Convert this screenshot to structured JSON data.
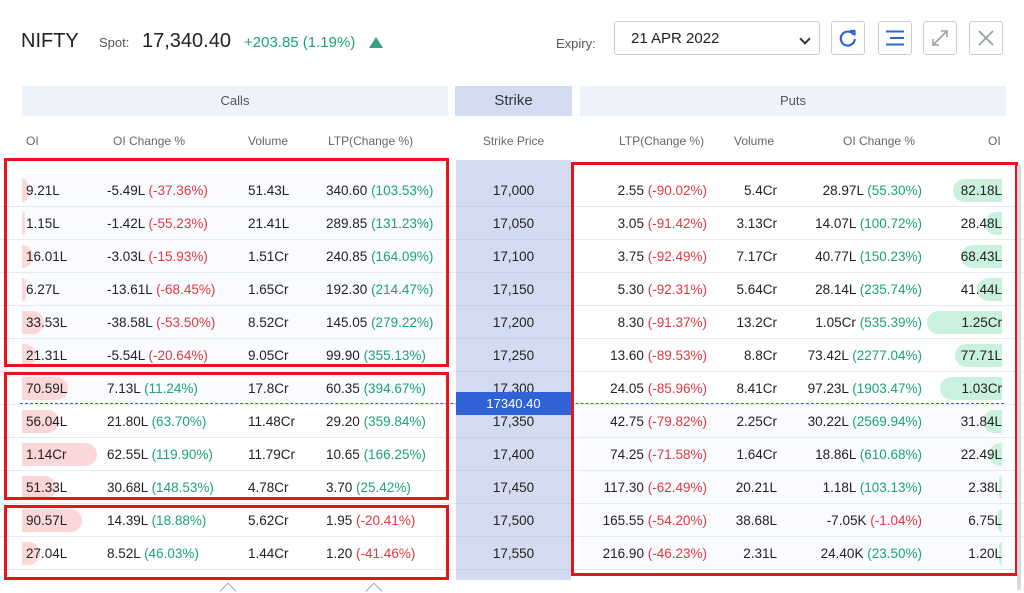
{
  "header": {
    "symbol": "NIFTY",
    "spot_label": "Spot:",
    "spot_value": "17,340.40",
    "spot_change": "+203.85 (1.19%)",
    "expiry_label": "Expiry:",
    "expiry_value": "21 APR 2022",
    "icons": [
      "refresh-icon",
      "menu-lines-icon",
      "expand-icon",
      "close-icon"
    ]
  },
  "sections": {
    "calls": "Calls",
    "strike": "Strike",
    "puts": "Puts"
  },
  "columns": {
    "calls": [
      "OI",
      "OI Change %",
      "Volume",
      "LTP(Change %)"
    ],
    "strike": "Strike Price",
    "puts": [
      "LTP(Change %)",
      "Volume",
      "OI Change %",
      "OI"
    ]
  },
  "spot_marker": "17340.40",
  "colors": {
    "accent": "#2f62d6",
    "positive": "#1aa37a",
    "negative": "#e0383e",
    "highlight": "#e8141c"
  },
  "rows": [
    {
      "strike": "17,000",
      "c_oi": "9.21L",
      "c_chg": "-5.49L",
      "c_chg_pct": "(-37.36%)",
      "c_vol": "51.43L",
      "c_ltp": "340.60",
      "c_ltp_pct": "(103.53%)",
      "p_ltp": "2.55",
      "p_ltp_pct": "(-90.02%)",
      "p_vol": "5.4Cr",
      "p_chg": "28.97L",
      "p_chg_pct": "(55.30%)",
      "p_oi": "82.18L"
    },
    {
      "strike": "17,050",
      "c_oi": "1.15L",
      "c_chg": "-1.42L",
      "c_chg_pct": "(-55.23%)",
      "c_vol": "21.41L",
      "c_ltp": "289.85",
      "c_ltp_pct": "(131.23%)",
      "p_ltp": "3.05",
      "p_ltp_pct": "(-91.42%)",
      "p_vol": "3.13Cr",
      "p_chg": "14.07L",
      "p_chg_pct": "(100.72%)",
      "p_oi": "28.48L"
    },
    {
      "strike": "17,100",
      "c_oi": "16.01L",
      "c_chg": "-3.03L",
      "c_chg_pct": "(-15.93%)",
      "c_vol": "1.51Cr",
      "c_ltp": "240.85",
      "c_ltp_pct": "(164.09%)",
      "p_ltp": "3.75",
      "p_ltp_pct": "(-92.49%)",
      "p_vol": "7.17Cr",
      "p_chg": "40.77L",
      "p_chg_pct": "(150.23%)",
      "p_oi": "68.43L"
    },
    {
      "strike": "17,150",
      "c_oi": "6.27L",
      "c_chg": "-13.61L",
      "c_chg_pct": "(-68.45%)",
      "c_vol": "1.65Cr",
      "c_ltp": "192.30",
      "c_ltp_pct": "(214.47%)",
      "p_ltp": "5.30",
      "p_ltp_pct": "(-92.31%)",
      "p_vol": "5.64Cr",
      "p_chg": "28.14L",
      "p_chg_pct": "(235.74%)",
      "p_oi": "41.44L"
    },
    {
      "strike": "17,200",
      "c_oi": "33.53L",
      "c_chg": "-38.58L",
      "c_chg_pct": "(-53.50%)",
      "c_vol": "8.52Cr",
      "c_ltp": "145.05",
      "c_ltp_pct": "(279.22%)",
      "p_ltp": "8.30",
      "p_ltp_pct": "(-91.37%)",
      "p_vol": "13.2Cr",
      "p_chg": "1.05Cr",
      "p_chg_pct": "(535.39%)",
      "p_oi": "1.25Cr"
    },
    {
      "strike": "17,250",
      "c_oi": "21.31L",
      "c_chg": "-5.54L",
      "c_chg_pct": "(-20.64%)",
      "c_vol": "9.05Cr",
      "c_ltp": "99.90",
      "c_ltp_pct": "(355.13%)",
      "p_ltp": "13.60",
      "p_ltp_pct": "(-89.53%)",
      "p_vol": "8.8Cr",
      "p_chg": "73.42L",
      "p_chg_pct": "(2277.04%)",
      "p_oi": "77.71L"
    },
    {
      "strike": "17,300",
      "c_oi": "70.59L",
      "c_chg": "7.13L",
      "c_chg_pct": "(11.24%)",
      "c_vol": "17.8Cr",
      "c_ltp": "60.35",
      "c_ltp_pct": "(394.67%)",
      "p_ltp": "24.05",
      "p_ltp_pct": "(-85.96%)",
      "p_vol": "8.41Cr",
      "p_chg": "97.23L",
      "p_chg_pct": "(1903.47%)",
      "p_oi": "1.03Cr"
    },
    {
      "strike": "17,350",
      "c_oi": "56.04L",
      "c_chg": "21.80L",
      "c_chg_pct": "(63.70%)",
      "c_vol": "11.48Cr",
      "c_ltp": "29.20",
      "c_ltp_pct": "(359.84%)",
      "p_ltp": "42.75",
      "p_ltp_pct": "(-79.82%)",
      "p_vol": "2.25Cr",
      "p_chg": "30.22L",
      "p_chg_pct": "(2569.94%)",
      "p_oi": "31.84L"
    },
    {
      "strike": "17,400",
      "c_oi": "1.14Cr",
      "c_chg": "62.55L",
      "c_chg_pct": "(119.90%)",
      "c_vol": "11.79Cr",
      "c_ltp": "10.65",
      "c_ltp_pct": "(166.25%)",
      "p_ltp": "74.25",
      "p_ltp_pct": "(-71.58%)",
      "p_vol": "1.64Cr",
      "p_chg": "18.86L",
      "p_chg_pct": "(610.68%)",
      "p_oi": "22.49L"
    },
    {
      "strike": "17,450",
      "c_oi": "51.33L",
      "c_chg": "30.68L",
      "c_chg_pct": "(148.53%)",
      "c_vol": "4.78Cr",
      "c_ltp": "3.70",
      "c_ltp_pct": "(25.42%)",
      "p_ltp": "117.30",
      "p_ltp_pct": "(-62.49%)",
      "p_vol": "20.21L",
      "p_chg": "1.18L",
      "p_chg_pct": "(103.13%)",
      "p_oi": "2.38L"
    },
    {
      "strike": "17,500",
      "c_oi": "90.57L",
      "c_chg": "14.39L",
      "c_chg_pct": "(18.88%)",
      "c_vol": "5.62Cr",
      "c_ltp": "1.95",
      "c_ltp_pct": "(-20.41%)",
      "p_ltp": "165.55",
      "p_ltp_pct": "(-54.20%)",
      "p_vol": "38.68L",
      "p_chg": "-7.05K",
      "p_chg_pct": "(-1.04%)",
      "p_oi": "6.75L"
    },
    {
      "strike": "17,550",
      "c_oi": "27.04L",
      "c_chg": "8.52L",
      "c_chg_pct": "(46.03%)",
      "c_vol": "1.44Cr",
      "c_ltp": "1.20",
      "c_ltp_pct": "(-41.46%)",
      "p_ltp": "216.90",
      "p_ltp_pct": "(-46.23%)",
      "p_vol": "2.31L",
      "p_chg": "24.40K",
      "p_chg_pct": "(23.50%)",
      "p_oi": "1.20L"
    }
  ]
}
